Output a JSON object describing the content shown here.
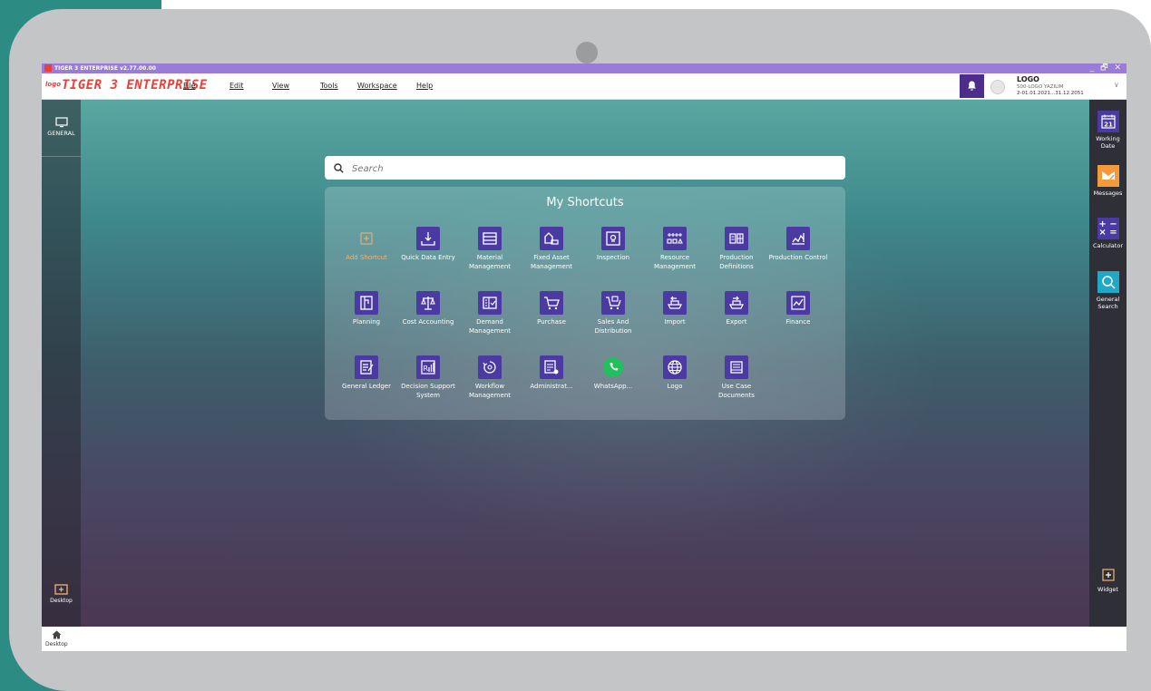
{
  "window": {
    "title": "TIGER 3 ENTERPRISE v2.77.00.00",
    "controls": "_ 🗗 ✕"
  },
  "brand": {
    "logo_mark": "logo",
    "name": "TIGER 3 ENTERPRISE"
  },
  "menu": {
    "file": "File",
    "edit": "Edit",
    "view": "View",
    "tools": "Tools",
    "workspace": "Workspace",
    "help": "Help"
  },
  "account": {
    "name": "LOGO",
    "company": "500-LOGO YAZILIM",
    "period": "2-01.01.2021...31.12.2051"
  },
  "left_nav": {
    "general": "GENERAL",
    "desktop": "Desktop"
  },
  "right_nav": {
    "working_date": "Working Date",
    "working_date_day": "21",
    "messages": "Messages",
    "calculator": "Calculator",
    "general_search": "General Search",
    "widget": "Widget"
  },
  "search": {
    "placeholder": "Search"
  },
  "shortcuts": {
    "title": "My Shortcuts",
    "add": "Add Shortcut",
    "items": [
      "Quick Data Entry",
      "Material Management",
      "Fixed Asset Management",
      "Inspection",
      "Resource Management",
      "Production Definitions",
      "Production Control",
      "Planning",
      "Cost Accounting",
      "Demand Management",
      "Purchase",
      "Sales And Distribution",
      "Import",
      "Export",
      "Finance",
      "General Ledger",
      "Decision Support System",
      "Workflow Management",
      "Administrat...",
      "WhatsApp...",
      "Logo",
      "Use Case Documents"
    ]
  },
  "footer": {
    "desktop": "Desktop"
  },
  "colors": {
    "accent": "#4b3aa2",
    "brand": "#e8413a",
    "titlebar": "#9b7bd9",
    "messages": "#f39a3c",
    "search_icon": "#20a8c4"
  }
}
